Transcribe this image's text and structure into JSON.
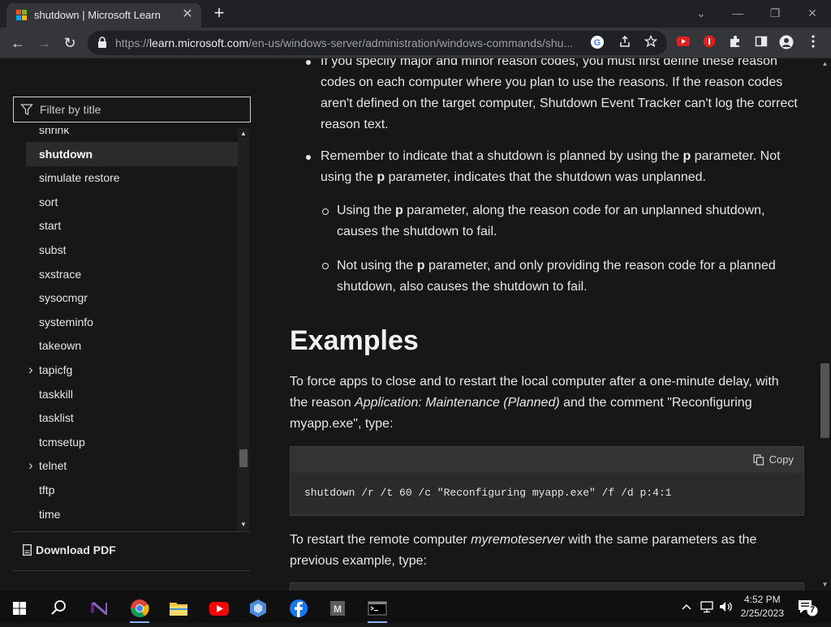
{
  "browser": {
    "tab_title": "shutdown | Microsoft Learn",
    "tab_close": "✕",
    "new_tab": "+",
    "url_prefix": "https://",
    "url_host": "learn.microsoft.com",
    "url_path": "/en-us/windows-server/administration/windows-commands/shu...",
    "window_controls": [
      "⌄",
      "—",
      "❐",
      "✕"
    ],
    "nav": {
      "back": "←",
      "forward": "→",
      "reload": "↻"
    }
  },
  "sidebar": {
    "filter_placeholder": "Filter by title",
    "items": [
      {
        "label": "shrink",
        "expandable": false,
        "active": false
      },
      {
        "label": "shutdown",
        "expandable": false,
        "active": true
      },
      {
        "label": "simulate restore",
        "expandable": false,
        "active": false
      },
      {
        "label": "sort",
        "expandable": false,
        "active": false
      },
      {
        "label": "start",
        "expandable": false,
        "active": false
      },
      {
        "label": "subst",
        "expandable": false,
        "active": false
      },
      {
        "label": "sxstrace",
        "expandable": false,
        "active": false
      },
      {
        "label": "sysocmgr",
        "expandable": false,
        "active": false
      },
      {
        "label": "systeminfo",
        "expandable": false,
        "active": false
      },
      {
        "label": "takeown",
        "expandable": false,
        "active": false
      },
      {
        "label": "tapicfg",
        "expandable": true,
        "active": false
      },
      {
        "label": "taskkill",
        "expandable": false,
        "active": false
      },
      {
        "label": "tasklist",
        "expandable": false,
        "active": false
      },
      {
        "label": "tcmsetup",
        "expandable": false,
        "active": false
      },
      {
        "label": "telnet",
        "expandable": true,
        "active": false
      },
      {
        "label": "tftp",
        "expandable": false,
        "active": false
      },
      {
        "label": "time",
        "expandable": false,
        "active": false
      }
    ],
    "download_pdf": "Download PDF"
  },
  "content": {
    "bullet1_lines": [
      "If you specify major and minor reason codes, you must first define these reason",
      "codes on each computer where you plan to use the reasons. If the reason codes",
      "aren't defined on the target computer, Shutdown Event Tracker can't log the correct",
      "reason text."
    ],
    "bullet2": {
      "line1_pre": "Remember to indicate that a shutdown is planned by using the ",
      "param": "p",
      "line1_post": " parameter. Not",
      "line2_pre": "using the ",
      "line2_post": " parameter, indicates that the shutdown was unplanned."
    },
    "sub1": {
      "line1_pre": "Using the ",
      "param": "p",
      "line1_post": " parameter, along the reason code for an unplanned shutdown,",
      "line2": "causes the shutdown to fail."
    },
    "sub2": {
      "line1_pre": "Not using the ",
      "param": "p",
      "line1_post": " parameter, and only providing the reason code for a planned",
      "line2": "shutdown, also causes the shutdown to fail."
    },
    "examples_heading": "Examples",
    "para1": {
      "line1": "To force apps to close and to restart the local computer after a one-minute delay, with",
      "line2_pre": "the reason ",
      "line2_em": "Application: Maintenance (Planned)",
      "line2_post": " and the comment \"Reconfiguring",
      "line3": "myapp.exe\", type:"
    },
    "copy_label": "Copy",
    "code1": "shutdown /r /t 60 /c \"Reconfiguring myapp.exe\" /f /d p:4:1",
    "para2": {
      "line1_pre": "To restart the remote computer ",
      "line1_em": "myremoteserver",
      "line1_post": " with the same parameters as the",
      "line2": "previous example, type:"
    }
  },
  "taskbar": {
    "time": "4:52 PM",
    "date": "2/25/2023",
    "notification_count": "7"
  }
}
